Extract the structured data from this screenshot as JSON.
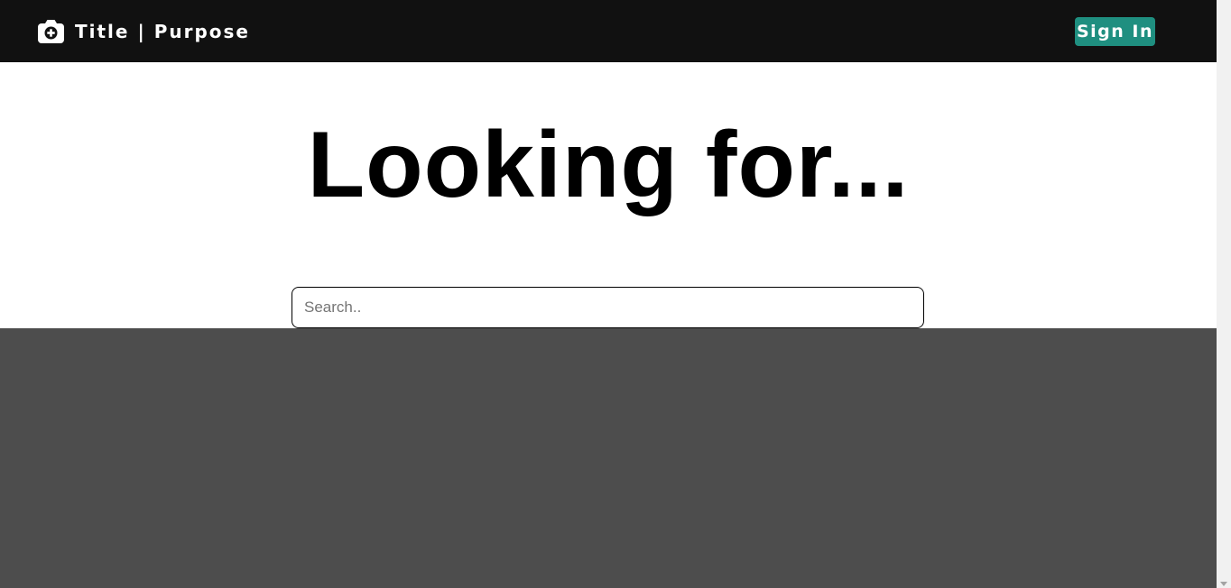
{
  "navbar": {
    "brand_icon": "camera-plus-icon",
    "brand_text": "Title | Purpose",
    "signin_label": "Sign In",
    "signin_color": "#1f8f80",
    "background": "#111111"
  },
  "hero": {
    "title": "Looking for..."
  },
  "search": {
    "placeholder": "Search..",
    "value": ""
  },
  "content": {
    "background": "#4d4d4d"
  }
}
